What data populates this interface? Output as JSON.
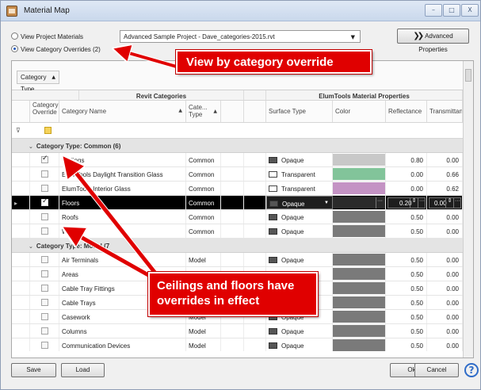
{
  "window": {
    "title": "Material Map",
    "minimize_glyph": "–",
    "maximize_glyph": "□",
    "close_glyph": "X"
  },
  "view_options": {
    "project_materials_label": "View Project Materials",
    "category_overrides_label": "View Category Overrides (2)",
    "selected": "category_overrides"
  },
  "project_select": {
    "value": "Advanced Sample Project - Dave_categories-2015.rvt"
  },
  "advanced_properties": {
    "label": "Advanced Properties"
  },
  "grouping": {
    "chip_label": "Category Type"
  },
  "columns": {
    "group_revit": "Revit Categories",
    "group_elum": "ElumTools Material Properties",
    "override": "Category Override",
    "category_name": "Category Name",
    "category_type": "Cate... Type",
    "surface_type": "Surface Type",
    "color": "Color",
    "reflectance": "Reflectance",
    "transmittance": "Transmittance"
  },
  "groups": [
    {
      "label": "Category Type: Common  (6)"
    },
    {
      "label": "Category Type: Model  (7"
    }
  ],
  "rows": [
    {
      "override": true,
      "name": "Ceilings",
      "type": "Common",
      "surface": "Opaque",
      "color": "#c8c8c8",
      "reflectance": "0.80",
      "transmittance": "0.00"
    },
    {
      "override": false,
      "name": "ElumTools Daylight Transition Glass",
      "type": "Common",
      "surface": "Transparent",
      "color": "#82c49a",
      "reflectance": "0.00",
      "transmittance": "0.66"
    },
    {
      "override": false,
      "name": "ElumTools Interior Glass",
      "type": "Common",
      "surface": "Transparent",
      "color": "#c493c4",
      "reflectance": "0.00",
      "transmittance": "0.62"
    },
    {
      "override": true,
      "name": "Floors",
      "type": "Common",
      "surface": "Opaque",
      "color": "#2a2a2a",
      "reflectance": "0.20",
      "transmittance": "0.00"
    },
    {
      "override": false,
      "name": "Roofs",
      "type": "Common",
      "surface": "Opaque",
      "color": "#7a7a7a",
      "reflectance": "0.50",
      "transmittance": "0.00"
    },
    {
      "override": false,
      "name": "Walls",
      "type": "Common",
      "surface": "Opaque",
      "color": "#7a7a7a",
      "reflectance": "0.50",
      "transmittance": "0.00"
    },
    {
      "override": false,
      "name": "Air Terminals",
      "type": "Model",
      "surface": "Opaque",
      "color": "#7a7a7a",
      "reflectance": "0.50",
      "transmittance": "0.00"
    },
    {
      "override": false,
      "name": "Areas",
      "type": "Model",
      "surface": "Opaque",
      "color": "#7a7a7a",
      "reflectance": "0.50",
      "transmittance": "0.00"
    },
    {
      "override": false,
      "name": "Cable Tray Fittings",
      "type": "Model",
      "surface": "Opaque",
      "color": "#7a7a7a",
      "reflectance": "0.50",
      "transmittance": "0.00"
    },
    {
      "override": false,
      "name": "Cable Trays",
      "type": "Model",
      "surface": "Opaque",
      "color": "#7a7a7a",
      "reflectance": "0.50",
      "transmittance": "0.00"
    },
    {
      "override": false,
      "name": "Casework",
      "type": "Model",
      "surface": "Opaque",
      "color": "#7a7a7a",
      "reflectance": "0.50",
      "transmittance": "0.00"
    },
    {
      "override": false,
      "name": "Columns",
      "type": "Model",
      "surface": "Opaque",
      "color": "#7a7a7a",
      "reflectance": "0.50",
      "transmittance": "0.00"
    },
    {
      "override": false,
      "name": "Communication Devices",
      "type": "Model",
      "surface": "Opaque",
      "color": "#7a7a7a",
      "reflectance": "0.50",
      "transmittance": "0.00"
    }
  ],
  "buttons": {
    "save": "Save",
    "load": "Load",
    "ok": "Ok",
    "cancel": "Cancel"
  },
  "annotations": {
    "callout_top": "View by category override",
    "callout_bottom": "Ceilings and floors have overrides in effect"
  },
  "colors": {
    "callout_red": "#e00000",
    "selected_row": "#000000"
  }
}
